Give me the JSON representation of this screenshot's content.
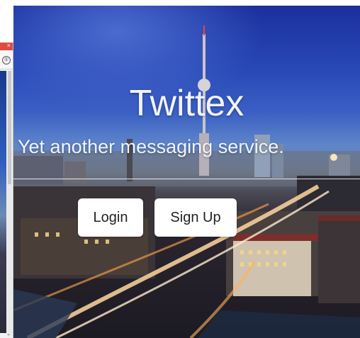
{
  "hero": {
    "title": "Twittex",
    "subtitle": "Yet another messaging service."
  },
  "buttons": {
    "login_label": "Login",
    "signup_label": "Sign Up"
  },
  "side_window": {
    "close_glyph": "×",
    "icon_glyph": "①",
    "scroll_down_glyph": "⌄"
  },
  "colors": {
    "sky_top": "#1b2f9c",
    "button_bg": "#ffffff",
    "title_text": "#f2f4fb",
    "side_titlebar": "#e04b40"
  }
}
